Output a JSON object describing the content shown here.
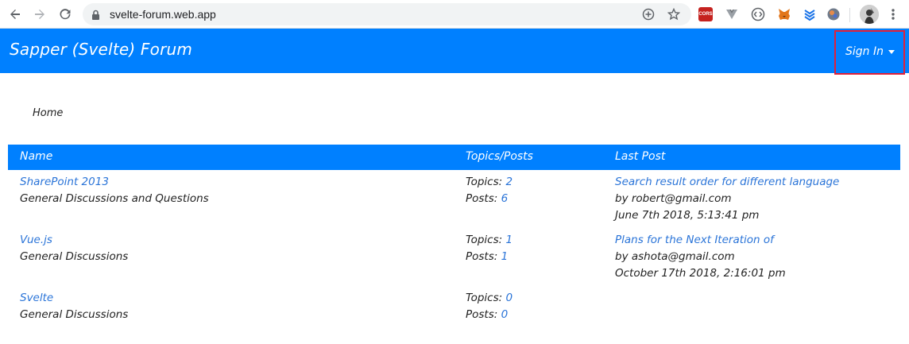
{
  "browser": {
    "url": "svelte-forum.web.app",
    "icons": [
      "back-arrow-icon",
      "forward-arrow-icon",
      "reload-icon",
      "lock-icon",
      "zoom-icon",
      "star-icon",
      "cors-extension-icon",
      "vue-extension-icon",
      "code-extension-icon",
      "metamask-fox-icon",
      "layers-extension-icon",
      "globe-extension-icon",
      "profile-avatar",
      "kebab-menu-icon"
    ],
    "cors_label": "CORS"
  },
  "header": {
    "brand": "Sapper (Svelte)  Forum",
    "signin_label": "Sign In",
    "colors": {
      "bar": "#0080ff",
      "highlight": "#e0203a"
    }
  },
  "breadcrumb": {
    "home": "Home"
  },
  "table": {
    "columns": [
      "Name",
      "Topics/Posts",
      "Last Post"
    ],
    "topics_prefix": "Topics: ",
    "posts_prefix": "Posts: ",
    "rows": [
      {
        "name": "SharePoint 2013",
        "description": "General Discussions and Questions",
        "topics": "2",
        "posts": "6",
        "last_post_title": "Search result order for different language",
        "last_post_by": "by robert@gmail.com",
        "last_post_date": "June 7th 2018, 5:13:41 pm"
      },
      {
        "name": "Vue.js",
        "description": "General Discussions",
        "topics": "1",
        "posts": "1",
        "last_post_title": "Plans for the Next Iteration of",
        "last_post_by": "by ashota@gmail.com",
        "last_post_date": "October 17th 2018, 2:16:01 pm"
      },
      {
        "name": "Svelte",
        "description": "General Discussions",
        "topics": "0",
        "posts": "0",
        "last_post_title": "",
        "last_post_by": "",
        "last_post_date": ""
      }
    ],
    "colors": {
      "header": "#0080ff",
      "link": "#2a74d8"
    }
  }
}
